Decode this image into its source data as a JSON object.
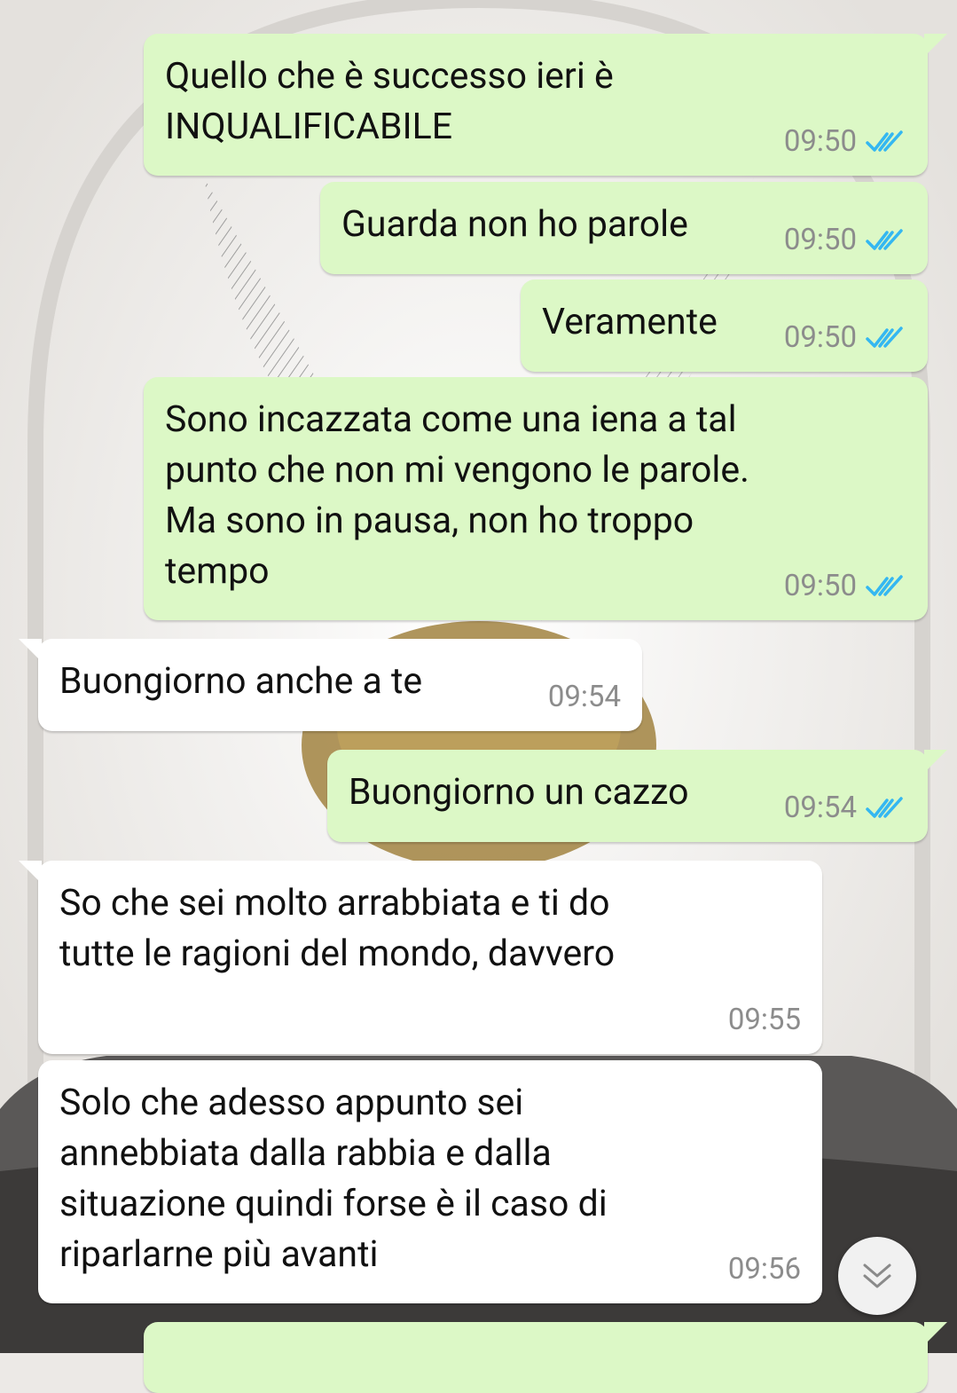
{
  "theme": {
    "outgoing_bg": "#dcf8c6",
    "incoming_bg": "#ffffff",
    "tick_color": "#34b7f1",
    "time_color": "#8c8c8c"
  },
  "messages": [
    {
      "direction": "outgoing",
      "text": "Quello che è successo ieri è\nINQUALIFICABILE",
      "time": "09:50",
      "status": "read"
    },
    {
      "direction": "outgoing",
      "text": "Guarda non ho parole",
      "time": "09:50",
      "status": "read"
    },
    {
      "direction": "outgoing",
      "text": "Veramente",
      "time": "09:50",
      "status": "read"
    },
    {
      "direction": "outgoing",
      "text": "Sono incazzata come una iena a tal\npunto che non mi vengono le parole.\nMa sono in pausa, non ho troppo\ntempo",
      "time": "09:50",
      "status": "read"
    },
    {
      "direction": "incoming",
      "text": "Buongiorno anche a te",
      "time": "09:54"
    },
    {
      "direction": "outgoing",
      "text": "Buongiorno un cazzo",
      "time": "09:54",
      "status": "read"
    },
    {
      "direction": "incoming",
      "text": "So che sei molto arrabbiata e ti do\ntutte le ragioni del mondo, davvero",
      "time": "09:55"
    },
    {
      "direction": "incoming",
      "text": "Solo che adesso appunto sei\nannebbiata dalla rabbia e dalla\nsituazione quindi forse è il caso di\nriparlarne più avanti",
      "time": "09:56"
    }
  ],
  "scroll_button": {
    "icon": "double-chevron-down-icon"
  }
}
